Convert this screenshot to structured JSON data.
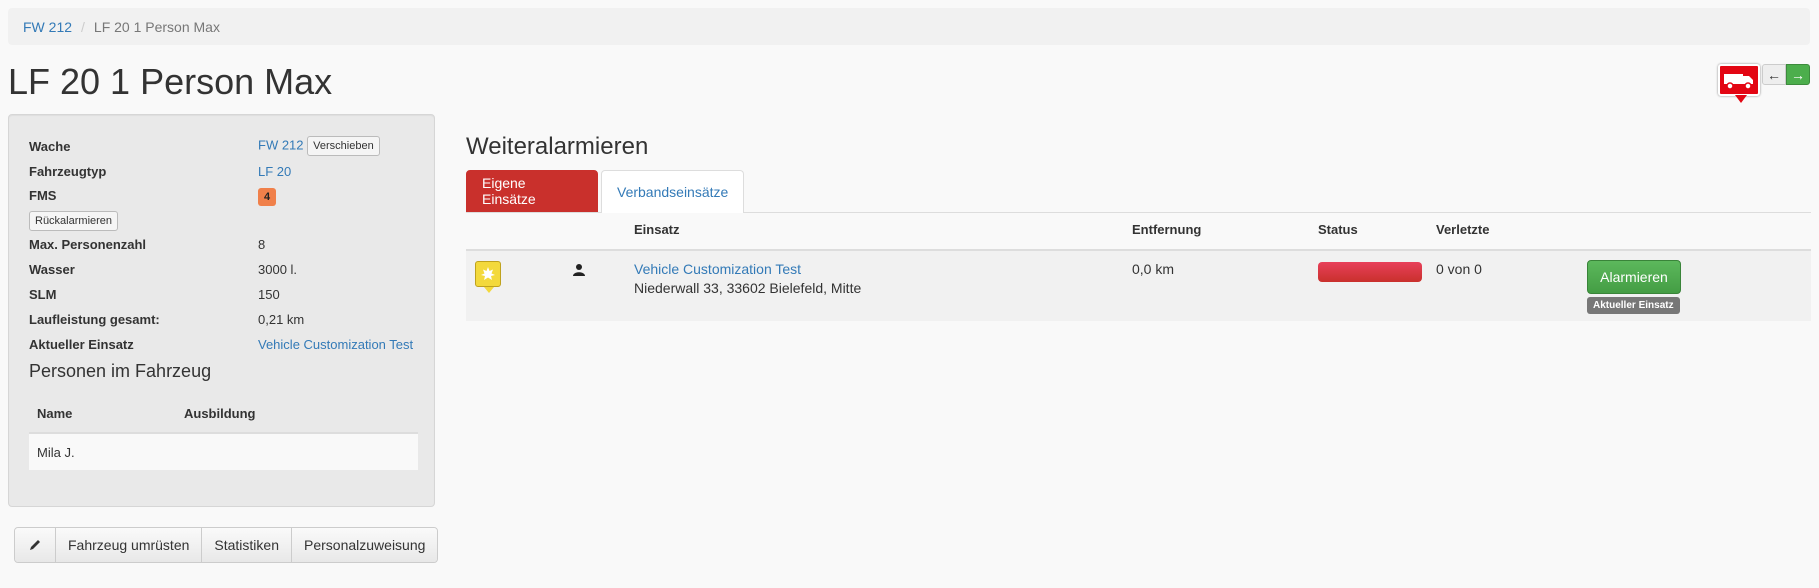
{
  "breadcrumb": {
    "parent": "FW 212",
    "separator": "/",
    "current": "LF 20 1 Person Max"
  },
  "page_title": "LF 20 1 Person Max",
  "nav": {
    "prev_icon": "arrow-left-icon",
    "next_icon": "arrow-right-icon",
    "prev_symbol": "←",
    "next_symbol": "→"
  },
  "vehicle_info": {
    "wache_label": "Wache",
    "wache_value": "FW 212",
    "verschieben_label": "Verschieben",
    "typ_label": "Fahrzeugtyp",
    "typ_value": "LF 20",
    "fms_label": "FMS",
    "fms_value": "4",
    "rueckalarm_label": "Rückalarmieren",
    "personen_label": "Max. Personenzahl",
    "personen_value": "8",
    "wasser_label": "Wasser",
    "wasser_value": "3000 l.",
    "slm_label": "SLM",
    "slm_value": "150",
    "lauf_label": "Laufleistung gesamt:",
    "lauf_value": "0,21 km",
    "einsatz_label": "Aktueller Einsatz",
    "einsatz_value": "Vehicle Customization Test"
  },
  "personen": {
    "title": "Personen im Fahrzeug",
    "headers": [
      "Name",
      "Ausbildung"
    ],
    "rows": [
      {
        "name": "Mila J.",
        "ausbildung": ""
      }
    ]
  },
  "bottom_buttons": {
    "edit_icon": "pencil-icon",
    "umruesten": "Fahrzeug umrüsten",
    "statistiken": "Statistiken",
    "personal": "Personalzuweisung"
  },
  "weiteralarm": {
    "title": "Weiteralarmieren",
    "tabs": [
      "Eigene Einsätze",
      "Verbandseinsätze"
    ],
    "headers": {
      "einsatz": "Einsatz",
      "entfernung": "Entfernung",
      "status": "Status",
      "verletzte": "Verletzte"
    },
    "missions": [
      {
        "name": "Vehicle Customization Test",
        "address": "Niederwall 33, 33602 Bielefeld, Mitte",
        "distance": "0,0 km",
        "verletzte": "0 von 0",
        "status_color": "#d9354f",
        "alarm_label": "Alarmieren",
        "current_label": "Aktueller Einsatz"
      }
    ]
  },
  "colors": {
    "brand_red": "#c9302c",
    "link": "#337ab7",
    "success": "#5cb85c",
    "fms": "#f0804a"
  }
}
